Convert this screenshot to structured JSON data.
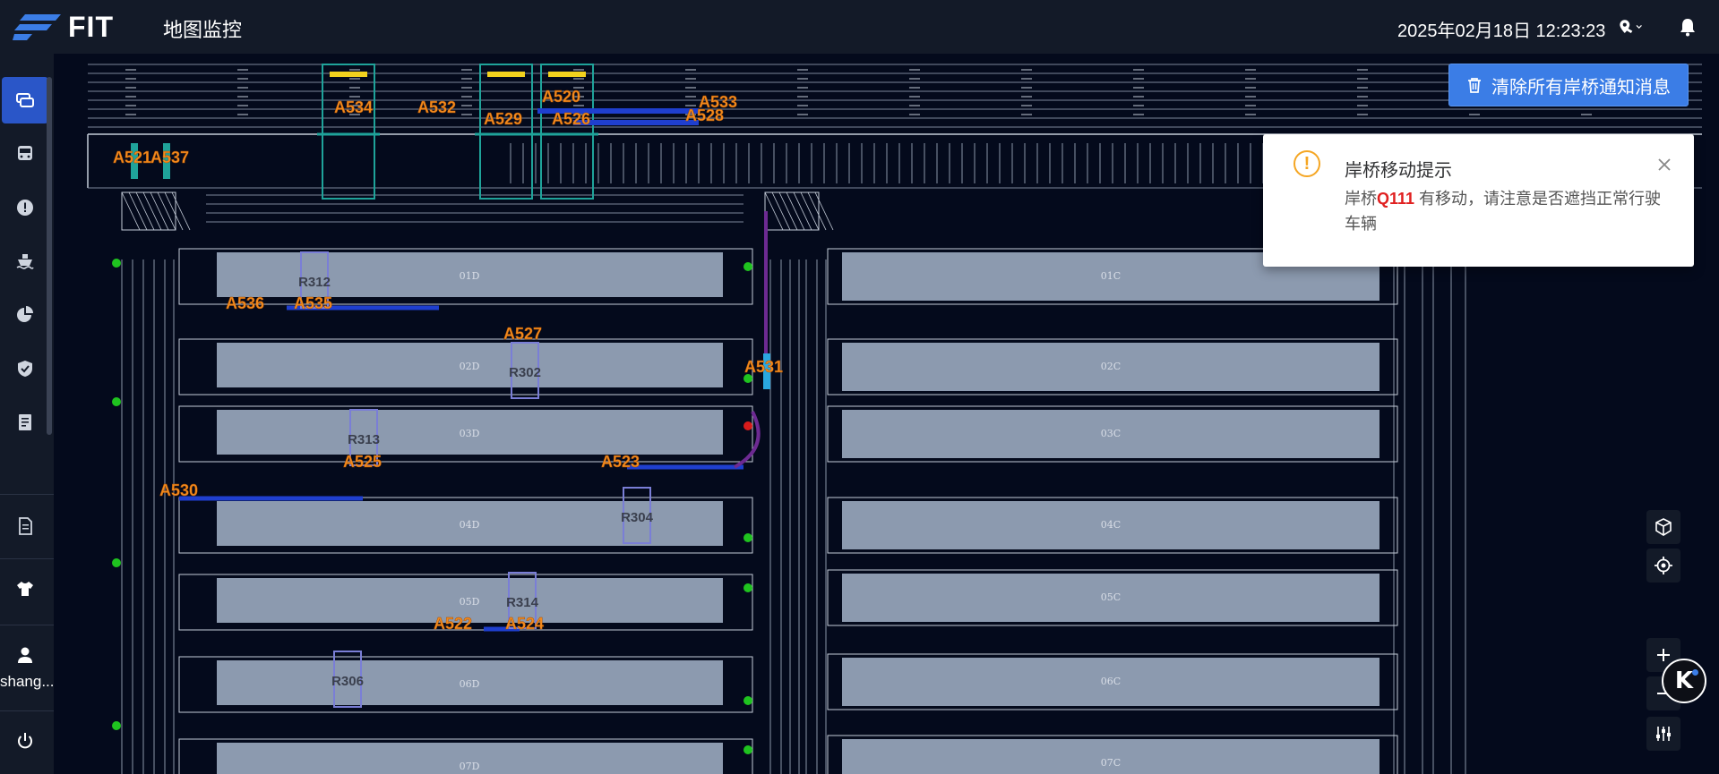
{
  "header": {
    "logo_text": "FIT",
    "title": "地图监控",
    "datetime": "2025年02月18日 12:23:23"
  },
  "sidebar": {
    "user_name": "shang..."
  },
  "toolbar": {
    "clear_label": "清除所有岸桥通知消息"
  },
  "notice": {
    "title": "岸桥移动提示",
    "body_prefix": "岸桥",
    "crane_id": "Q111",
    "body_suffix": " 有移动，请注意是否遮挡正常行驶车辆"
  },
  "yards_left": [
    "01D",
    "02D",
    "03D",
    "04D",
    "05D",
    "06D",
    "07D"
  ],
  "yards_right": [
    "01C",
    "02C",
    "03C",
    "04C",
    "05C",
    "06C",
    "07C"
  ],
  "gantry_labels": [
    "R312",
    "R302",
    "R313",
    "R304",
    "R314",
    "R306"
  ],
  "vehicle_labels": [
    "A534",
    "A532",
    "A529",
    "A520",
    "A526",
    "A533",
    "A528",
    "A521",
    "A537",
    "A536",
    "A535",
    "A527",
    "A531",
    "A525",
    "A523",
    "A530",
    "A522",
    "A524"
  ],
  "colors": {
    "accent": "#3b7de6",
    "vehicle_label": "#f28a1e",
    "yard_block": "#8c9aaf",
    "crane": "#1fa39a",
    "crane_bar": "#f2d21e",
    "route": "#1f3fcf"
  }
}
